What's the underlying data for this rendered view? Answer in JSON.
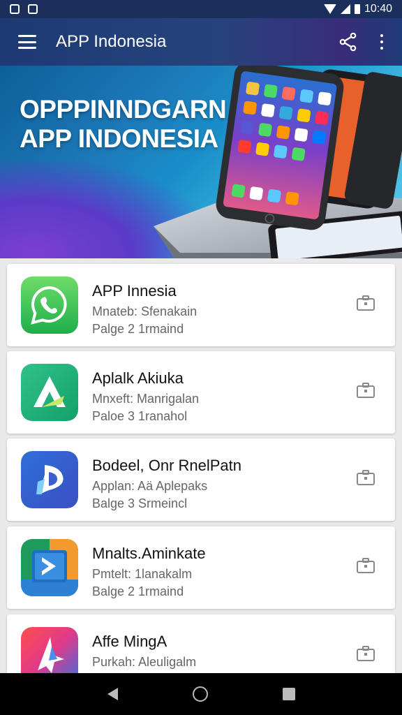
{
  "status_bar": {
    "time": "10:40"
  },
  "app_bar": {
    "title": "APP Indonesia"
  },
  "hero": {
    "line1": "OPPPINNDGARN",
    "line2": "APP INDONESIA"
  },
  "apps": [
    {
      "name": "APP Innesia",
      "meta1": "Mnateb: Sfenakain",
      "meta2": "Palge 2 1rmaind",
      "icon": "whatsapp-icon"
    },
    {
      "name": "Aplalk Akiuka",
      "meta1": "Mnxeft: Manrigalan",
      "meta2": "Paloe 3 1ranahol",
      "icon": "triangle-logo-icon"
    },
    {
      "name": "Bodeel, Onr RnelPatn",
      "meta1": "Applan: Aä Aplepaks",
      "meta2": "Balge 3 Srmeincl",
      "icon": "play-logo-icon"
    },
    {
      "name": "Mnalts.Aminkate",
      "meta1": "Pmtelt: 1lanakalm",
      "meta2": "Balge 2 1rmaind",
      "icon": "forward-logo-icon"
    },
    {
      "name": "Affe MingA",
      "meta1": "Purkah: Aleuligalm",
      "meta2": "",
      "icon": "star-logo-icon"
    }
  ],
  "colors": {
    "app_bar": "#1d3a74",
    "status_bar": "#1b2f5c",
    "background": "#e9e9ec"
  }
}
